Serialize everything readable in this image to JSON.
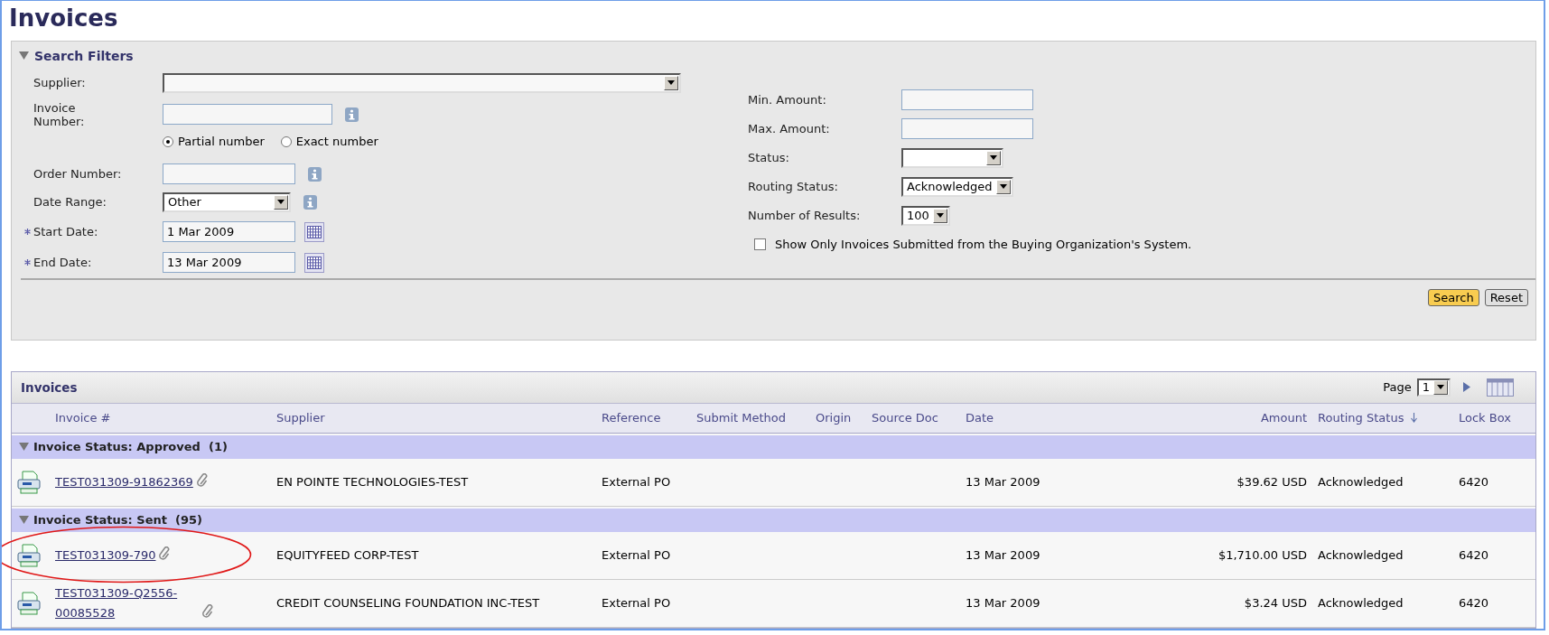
{
  "title": "Invoices",
  "filters": {
    "title": "Search Filters",
    "expanded": true,
    "supplier": {
      "label": "Supplier:"
    },
    "invoice_number": {
      "label": "Invoice Number:",
      "options": [
        {
          "label": "Partial number",
          "selected": true
        },
        {
          "label": "Exact number",
          "selected": false
        }
      ]
    },
    "order_number": {
      "label": "Order Number:"
    },
    "date_range": {
      "label": "Date Range:",
      "value": "Other"
    },
    "start_date": {
      "label": "Start Date:",
      "required": true,
      "value": "1 Mar 2009"
    },
    "end_date": {
      "label": "End Date:",
      "required": true,
      "value": "13 Mar 2009"
    },
    "min_amount": {
      "label": "Min. Amount:"
    },
    "max_amount": {
      "label": "Max. Amount:"
    },
    "status": {
      "label": "Status:"
    },
    "routing_status": {
      "label": "Routing Status:",
      "value": "Acknowledged"
    },
    "number_of_results": {
      "label": "Number of Results:",
      "value": "100"
    },
    "buying_org_only": {
      "label": "Show Only Invoices Submitted from the Buying Organization's System.",
      "checked": false
    },
    "buttons": [
      {
        "label": "Search",
        "primary": true
      },
      {
        "label": "Reset",
        "primary": false
      }
    ]
  },
  "invoices": {
    "title": "Invoices",
    "page_label": "Page",
    "page": "1",
    "columns": [
      {
        "label": "Invoice #",
        "sorted": false
      },
      {
        "label": "Supplier",
        "sorted": false
      },
      {
        "label": "Reference",
        "sorted": false
      },
      {
        "label": "Submit Method",
        "sorted": false
      },
      {
        "label": "Origin",
        "sorted": false
      },
      {
        "label": "Source Doc",
        "sorted": false
      },
      {
        "label": "Date",
        "sorted": false
      },
      {
        "label": "Amount",
        "sorted": false
      },
      {
        "label": "Routing Status",
        "sorted": true
      },
      {
        "label": "Lock Box",
        "sorted": false
      }
    ],
    "groups": [
      {
        "label": "Invoice Status: Approved",
        "count": "(1)",
        "expanded": true,
        "rows": [
          {
            "invoice": "TEST031309-91862369",
            "attachment": true,
            "circled": false,
            "supplier": "EN POINTE TECHNOLOGIES-TEST",
            "reference": "External PO",
            "date": "13 Mar 2009",
            "amount": "$39.62 USD",
            "routing_status": "Acknowledged",
            "lock_box": "6420"
          }
        ]
      },
      {
        "label": "Invoice Status: Sent",
        "count": "(95)",
        "expanded": true,
        "rows": [
          {
            "invoice": "TEST031309-790",
            "attachment": true,
            "circled": true,
            "supplier": "EQUITYFEED CORP-TEST",
            "reference": "External PO",
            "date": "13 Mar 2009",
            "amount": "$1,710.00 USD",
            "routing_status": "Acknowledged",
            "lock_box": "6420"
          },
          {
            "invoice": "TEST031309-Q2556-00085528",
            "attachment": true,
            "circled": false,
            "supplier": "CREDIT COUNSELING FOUNDATION INC-TEST",
            "reference": "External PO",
            "date": "13 Mar 2009",
            "amount": "$3.24 USD",
            "routing_status": "Acknowledged",
            "lock_box": "6420"
          }
        ]
      }
    ]
  }
}
